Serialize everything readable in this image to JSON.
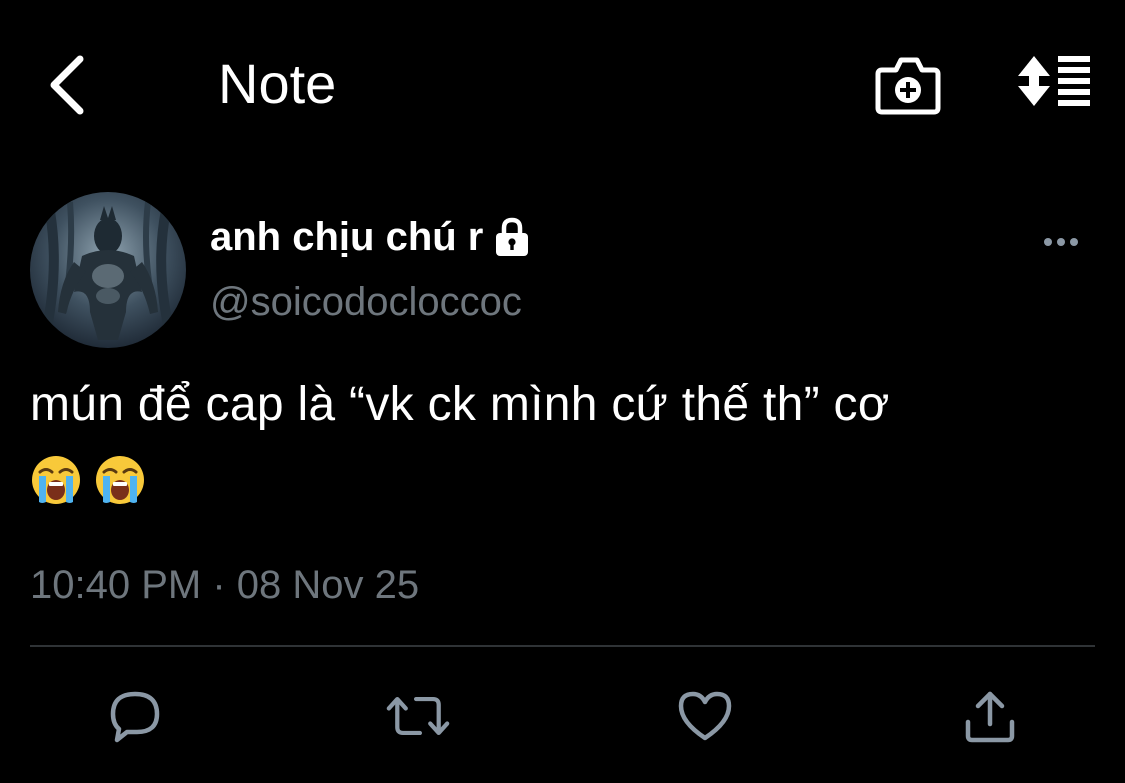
{
  "header": {
    "title": "Note",
    "back_icon": "chevron-left-icon",
    "camera_icon": "camera-plus-icon",
    "sort_icon": "sort-lines-icon"
  },
  "author": {
    "display_name": "anh chịu chú r",
    "handle": "@soicodocloccoc",
    "protected_icon": "lock-icon",
    "avatar_icon": "werewolf-avatar"
  },
  "tweet": {
    "text": "mún để cap là “vk ck mình cứ thế th” cơ",
    "emojis": [
      "😭",
      "😭"
    ],
    "timestamp": "10:40 PM · 08 Nov 25"
  },
  "actions": [
    {
      "name": "reply",
      "icon": "reply-bubble-icon"
    },
    {
      "name": "retweet",
      "icon": "retweet-icon"
    },
    {
      "name": "like",
      "icon": "heart-icon"
    },
    {
      "name": "share",
      "icon": "share-upload-icon"
    }
  ],
  "colors": {
    "background": "#000000",
    "text": "#ffffff",
    "secondary_text": "#6e767d",
    "divider": "#2f3336"
  }
}
